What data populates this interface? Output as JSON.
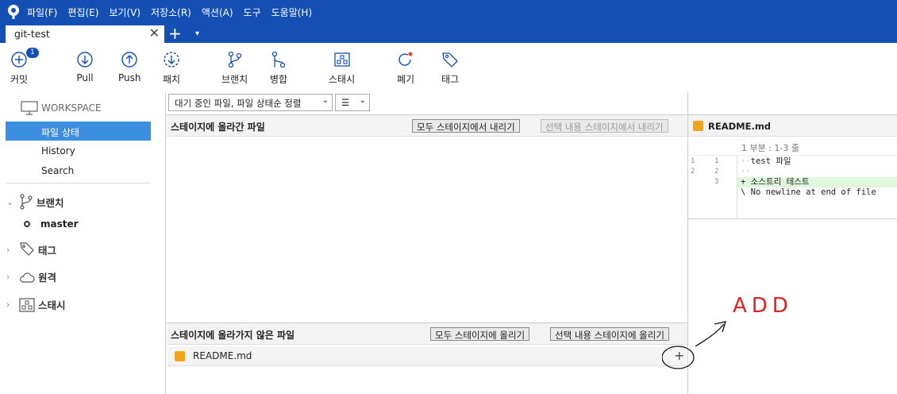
{
  "menu": [
    "파일(F)",
    "편집(E)",
    "보기(V)",
    "저장소(R)",
    "액션(A)",
    "도구",
    "도움말(H)"
  ],
  "tab": {
    "title": "git-test",
    "close": "✕",
    "add": "+",
    "dropdown": "▾"
  },
  "toolbar": {
    "commit": {
      "label": "커밋",
      "badge": "1"
    },
    "pull": {
      "label": "Pull"
    },
    "push": {
      "label": "Push"
    },
    "patch": {
      "label": "패치"
    },
    "branch": {
      "label": "브랜치"
    },
    "merge": {
      "label": "병합"
    },
    "stash": {
      "label": "스태시"
    },
    "discard": {
      "label": "폐기"
    },
    "tag": {
      "label": "태그"
    }
  },
  "sidebar": {
    "workspace": "WORKSPACE",
    "items": [
      {
        "label": "파일 상태",
        "selected": true
      },
      {
        "label": "History"
      },
      {
        "label": "Search"
      }
    ],
    "branches_label": "브랜치",
    "current_branch": "master",
    "tags_label": "태그",
    "remotes_label": "원격",
    "stashes_label": "스태시"
  },
  "filter": {
    "status_filter": "대기 중인 파일, 파일 상태순 정렬",
    "view_mode": "☰"
  },
  "staged": {
    "title": "스테이지에 올라간 파일",
    "unstage_all": "모두 스테이지에서 내리기",
    "unstage_selected": "선택 내용 스테이지에서 내리기"
  },
  "unstaged": {
    "title": "스테이지에 올라가지 않은 파일",
    "stage_all": "모두 스테이지에 올리기",
    "stage_selected": "선택 내용 스테이지에 올리기",
    "files": [
      {
        "name": "README.md",
        "action": "+"
      }
    ]
  },
  "diff": {
    "file": "README.md",
    "hunk": "1 부분 : 1-3 줄",
    "lines": [
      {
        "old": "1",
        "new": "1",
        "text": "test 파일",
        "type": "context"
      },
      {
        "old": "2",
        "new": "2",
        "text": "",
        "type": "context"
      },
      {
        "old": "",
        "new": "3",
        "text": "+ 소스트리 테스트",
        "type": "added"
      },
      {
        "old": "",
        "new": "",
        "text": "\\ No newline at end of file",
        "type": "meta"
      }
    ]
  },
  "annotation": {
    "text": "ADD",
    "color": "#e02020"
  },
  "colors": {
    "brand": "#1450b4",
    "selection": "#3c8ee0",
    "added": "#dff7dd",
    "md_icon": "#f2a51a"
  }
}
